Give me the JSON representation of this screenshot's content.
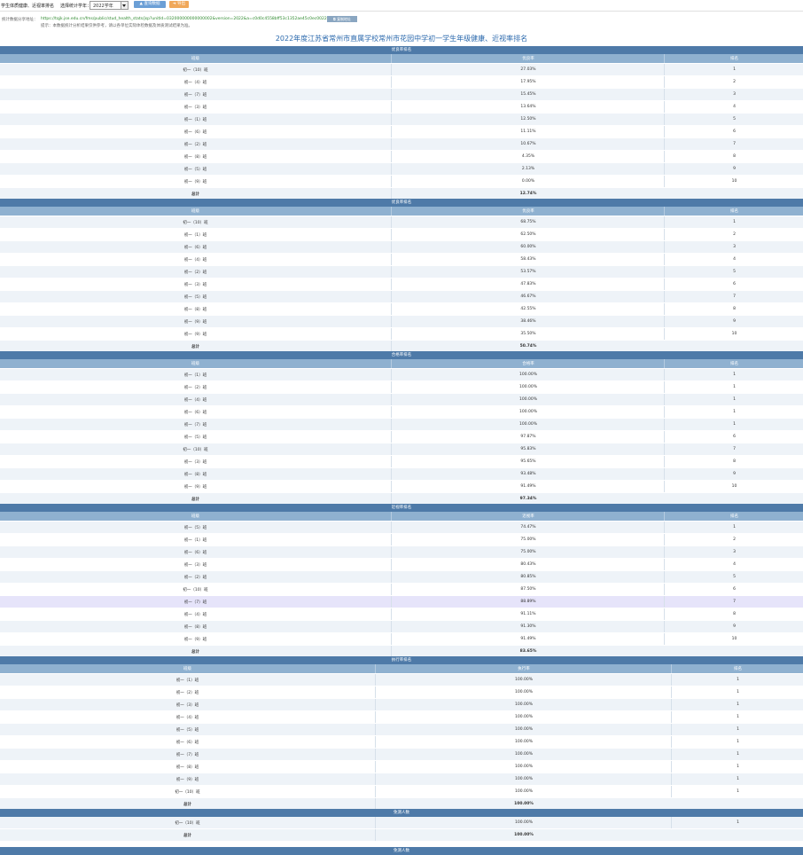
{
  "toolbar": {
    "page_label": "学生体质健康、近视率排名",
    "select_label": "选择统计学年：",
    "selected_year": "2022学年",
    "query_button": "查询数据",
    "export_button": "导出"
  },
  "share": {
    "label": "统计数据分享地址：",
    "url": "https://tqjk.jse.edu.cn/fms/public/stud_health_stats/jsp?unitId=032000000000000002&version=2022&a=c0d0c4558bff53c1352ae45c0ec00222",
    "copy_button": "复制地址",
    "note": "提示：本数据统计分析结果仅供参考，请以各单位实际体检数据及体质测试结果为准。"
  },
  "report_title": "2022年度江苏省常州市直属学校常州市花园中学初一学生年级健康、近视率排名",
  "sections": [
    {
      "title": "优良率排名",
      "columns": [
        "班级",
        "优良率",
        "排名"
      ],
      "rows": [
        [
          "初一（10）班",
          "27.03%",
          "1"
        ],
        [
          "初一（4）班",
          "17.95%",
          "2"
        ],
        [
          "初一（7）班",
          "15.45%",
          "3"
        ],
        [
          "初一（3）班",
          "13.64%",
          "4"
        ],
        [
          "初一（1）班",
          "12.50%",
          "5"
        ],
        [
          "初一（6）班",
          "11.11%",
          "6"
        ],
        [
          "初一（2）班",
          "10.67%",
          "7"
        ],
        [
          "初一（8）班",
          "4.35%",
          "8"
        ],
        [
          "初一（5）班",
          "2.13%",
          "9"
        ],
        [
          "初一（9）班",
          "0.00%",
          "10"
        ]
      ],
      "total": [
        "总计",
        "12.74%"
      ]
    },
    {
      "title": "优良率排名",
      "columns": [
        "班级",
        "优良率",
        "排名"
      ],
      "rows": [
        [
          "初一（10）班",
          "68.75%",
          "1"
        ],
        [
          "初一（1）班",
          "62.50%",
          "2"
        ],
        [
          "初一（6）班",
          "60.00%",
          "3"
        ],
        [
          "初一（4）班",
          "58.43%",
          "4"
        ],
        [
          "初一（2）班",
          "53.57%",
          "5"
        ],
        [
          "初一（3）班",
          "47.83%",
          "6"
        ],
        [
          "初一（5）班",
          "46.67%",
          "7"
        ],
        [
          "初一（8）班",
          "42.55%",
          "8"
        ],
        [
          "初一（9）班",
          "38.46%",
          "9"
        ],
        [
          "初一（9）班",
          "35.50%",
          "10"
        ]
      ],
      "total": [
        "总计",
        "50.74%"
      ]
    },
    {
      "title": "合格率排名",
      "columns": [
        "班级",
        "合格率",
        "排名"
      ],
      "rows": [
        [
          "初一（1）班",
          "100.00%",
          "1"
        ],
        [
          "初一（2）班",
          "100.00%",
          "1"
        ],
        [
          "初一（4）班",
          "100.00%",
          "1"
        ],
        [
          "初一（6）班",
          "100.00%",
          "1"
        ],
        [
          "初一（7）班",
          "100.00%",
          "1"
        ],
        [
          "初一（5）班",
          "97.87%",
          "6"
        ],
        [
          "初一（10）班",
          "95.83%",
          "7"
        ],
        [
          "初一（3）班",
          "95.65%",
          "8"
        ],
        [
          "初一（8）班",
          "93.48%",
          "9"
        ],
        [
          "初一（9）班",
          "91.49%",
          "10"
        ]
      ],
      "total": [
        "总计",
        "97.34%"
      ]
    },
    {
      "title": "近视率排名",
      "columns": [
        "班级",
        "近视率",
        "排名"
      ],
      "rows": [
        [
          "初一（5）班",
          "74.47%",
          "1"
        ],
        [
          "初一（1）班",
          "75.00%",
          "2"
        ],
        [
          "初一（6）班",
          "75.00%",
          "3"
        ],
        [
          "初一（3）班",
          "80.43%",
          "4"
        ],
        [
          "初一（2）班",
          "80.85%",
          "5"
        ],
        [
          "初一（10）班",
          "87.50%",
          "6"
        ],
        [
          "初一（7）班",
          "88.89%",
          "7"
        ],
        [
          "初一（4）班",
          "91.11%",
          "8"
        ],
        [
          "初一（8）班",
          "91.30%",
          "9"
        ],
        [
          "初一（9）班",
          "91.49%",
          "10"
        ]
      ],
      "total": [
        "总计",
        "83.65%"
      ]
    },
    {
      "title": "执行率排名",
      "columns": [
        "班级",
        "执行率",
        "排名"
      ],
      "rows": [
        [
          "初一（1）班",
          "100.00%",
          "1"
        ],
        [
          "初一（2）班",
          "100.00%",
          "1"
        ],
        [
          "初一（3）班",
          "100.00%",
          "1"
        ],
        [
          "初一（4）班",
          "100.00%",
          "1"
        ],
        [
          "初一（5）班",
          "100.00%",
          "1"
        ],
        [
          "初一（6）班",
          "100.00%",
          "1"
        ],
        [
          "初一（7）班",
          "100.00%",
          "1"
        ],
        [
          "初一（8）班",
          "100.00%",
          "1"
        ],
        [
          "初一（9）班",
          "100.00%",
          "1"
        ],
        [
          "初一（10）班",
          "100.00%",
          "1"
        ]
      ],
      "total": [
        "总计",
        "100.00%"
      ]
    },
    {
      "title": "免测人数",
      "columns": [],
      "rows": [
        [
          "初一（10）班",
          "100.00%",
          "1"
        ]
      ],
      "total": [
        "总计",
        "100.00%"
      ]
    }
  ],
  "next_section_title": "免测人数"
}
